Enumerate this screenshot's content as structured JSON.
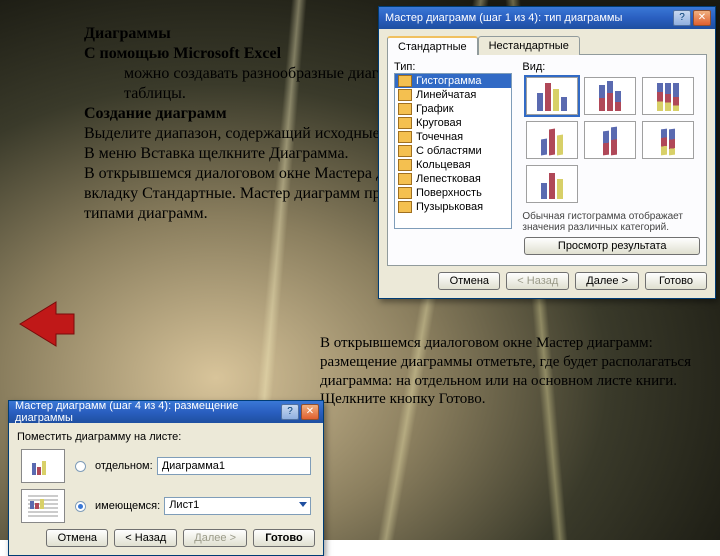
{
  "article": {
    "h1": "Диаграммы",
    "p1a": "С помощью Microsoft Excel",
    "p1b": "можно создавать разнообразные диаграммы на основе данных таблицы.",
    "h2": "Создание диаграмм",
    "p2": "Выделите диапазон, содержащий исходные данные.",
    "p3": "В меню Вставка щелкните Диаграмма.",
    "p4": "В открывшемся диалоговом окне Мастера диаграмм перейдите на вкладку Стандартные. Мастер диаграмм предоставляет набор рисунков с типами диаграмм."
  },
  "article2": {
    "text": "В открывшемся диалоговом окне Мастер диаграмм: размещение диаграммы отметьте, где будет располагаться диаграмма: на отдельном или на основном листе книги. Щелкните кнопку Готово."
  },
  "nav": {
    "back_label": "back-arrow"
  },
  "dlg1": {
    "title": "Мастер диаграмм (шаг 1 из 4): тип диаграммы",
    "tab1": "Стандартные",
    "tab2": "Нестандартные",
    "label_type": "Тип:",
    "label_view": "Вид:",
    "types": [
      "Гистограмма",
      "Линейчатая",
      "График",
      "Круговая",
      "Точечная",
      "С областями",
      "Кольцевая",
      "Лепестковая",
      "Поверхность",
      "Пузырьковая"
    ],
    "selected_type": "Гистограмма",
    "desc": "Обычная гистограмма отображает значения различных категорий.",
    "preview_chk": "Просмотр результата",
    "btn_cancel": "Отмена",
    "btn_back": "< Назад",
    "btn_next": "Далее >",
    "btn_done": "Готово",
    "help": "?",
    "close": "✕"
  },
  "dlg2": {
    "title": "Мастер диаграмм (шаг 4 из 4): размещение диаграммы",
    "legend": "Поместить диаграмму на листе:",
    "opt1_label": "отдельном:",
    "opt1_value": "Диаграмма1",
    "opt2_label": "имеющемся:",
    "opt2_value": "Лист1",
    "btn_cancel": "Отмена",
    "btn_back": "< Назад",
    "btn_next": "Далее >",
    "btn_done": "Готово",
    "help": "?",
    "close": "✕"
  },
  "colors": {
    "accent": "#2a5fc0",
    "bar_a": "#5a6ab0",
    "bar_b": "#b04858",
    "bar_c": "#d8d068",
    "sel": "#316ac5"
  }
}
